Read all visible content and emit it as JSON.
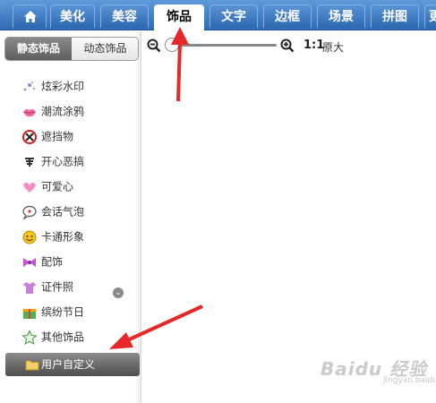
{
  "tabs": [
    {
      "label": ""
    },
    {
      "label": "美化"
    },
    {
      "label": "美容"
    },
    {
      "label": "饰品"
    },
    {
      "label": "文字"
    },
    {
      "label": "边框"
    },
    {
      "label": "场景"
    },
    {
      "label": "拼图"
    },
    {
      "label": "更"
    }
  ],
  "active_tab": "饰品",
  "subtabs": {
    "static": "静态饰品",
    "dynamic": "动态饰品"
  },
  "categories": [
    {
      "label": "炫彩水印",
      "icon": "sparkle-icon"
    },
    {
      "label": "潮流涂鸦",
      "icon": "lips-icon"
    },
    {
      "label": "遮挡物",
      "icon": "no-sign-icon"
    },
    {
      "label": "开心恶搞",
      "icon": "text-gao-icon"
    },
    {
      "label": "可爱心",
      "icon": "heart-icon"
    },
    {
      "label": "会话气泡",
      "icon": "speech-bubble-icon"
    },
    {
      "label": "卡通形象",
      "icon": "cartoon-face-icon"
    },
    {
      "label": "配饰",
      "icon": "bow-icon"
    },
    {
      "label": "证件照",
      "icon": "shirt-icon"
    },
    {
      "label": "缤纷节日",
      "icon": "gift-icon"
    },
    {
      "label": "其他饰品",
      "icon": "star-icon"
    }
  ],
  "custom": {
    "label": "用户自定义",
    "icon": "folder-icon"
  },
  "zoom": {
    "one_to_one": "1:1",
    "original": "原大"
  },
  "watermark": {
    "main": "Baidu 经验",
    "sub": "jingyan.baidu.com"
  }
}
